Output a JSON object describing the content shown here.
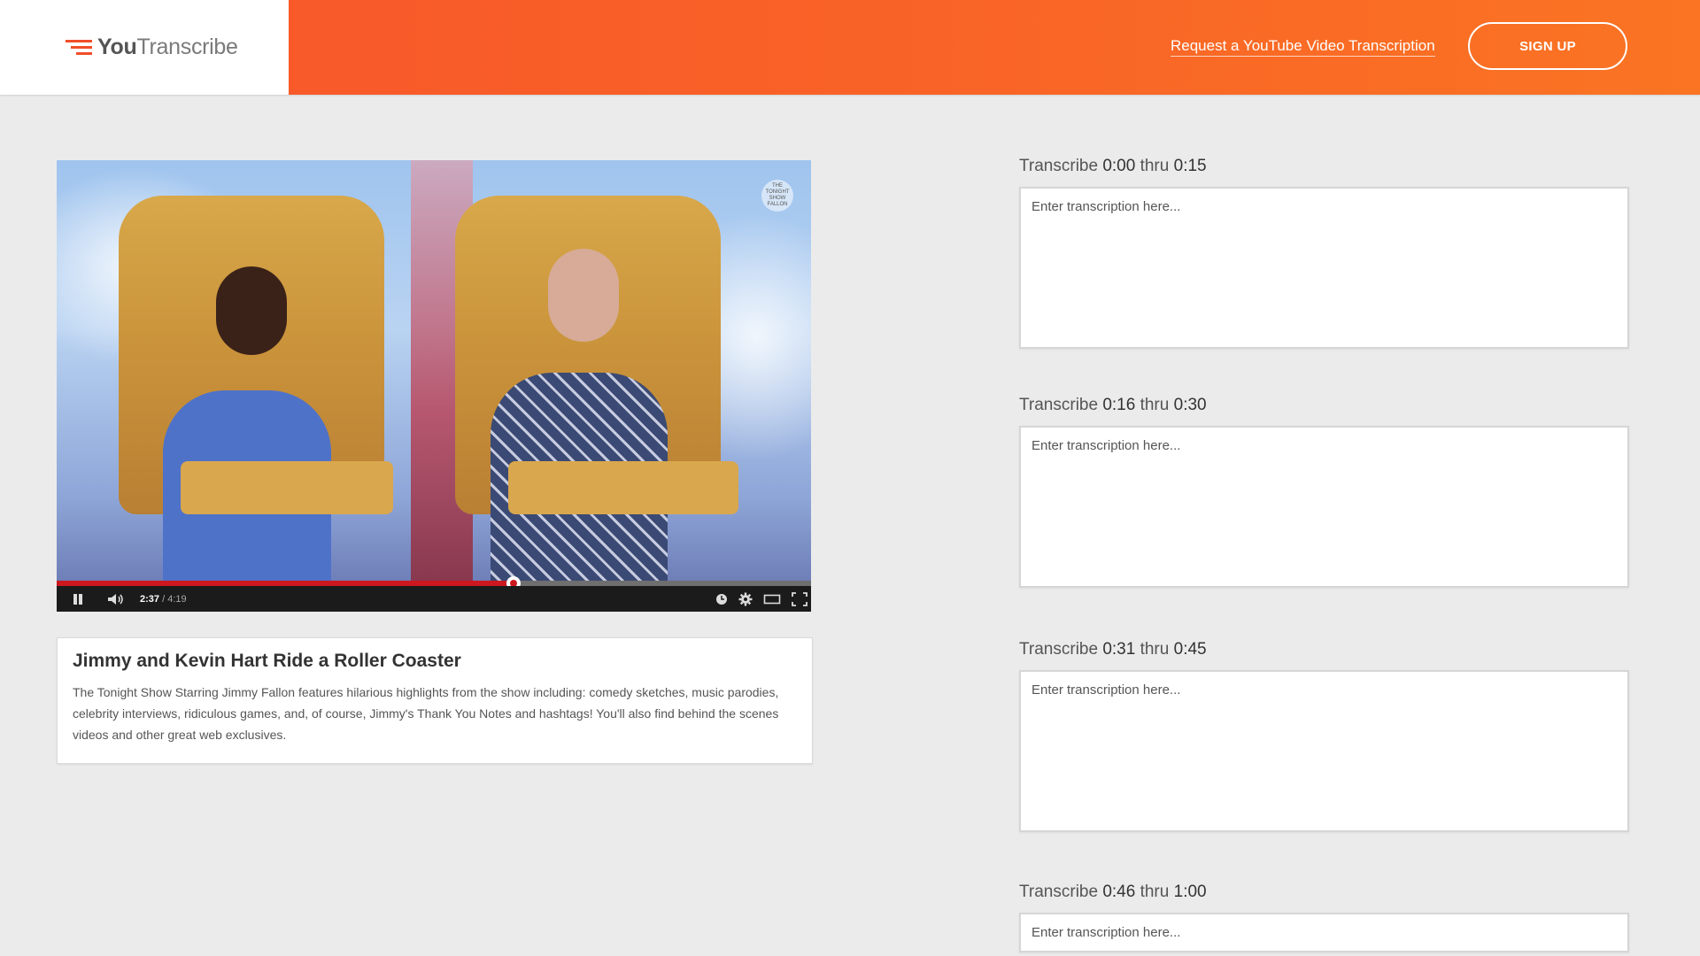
{
  "header": {
    "logo_you": "You",
    "logo_transcribe": "Transcribe",
    "request_link": "Request a YouTube Video Transcription",
    "signup_label": "SIGN UP",
    "colors": {
      "gradient_start": "#f8552a",
      "gradient_end": "#fa7423",
      "logo_mark": "#f04e2a"
    }
  },
  "video": {
    "time_current": "2:37",
    "time_separator": " / ",
    "time_total": "4:19",
    "progress": 0.6062,
    "progress_color": "#cc181e",
    "channel_badge": "THE TONIGHT SHOW FALLON",
    "icons": [
      "pause-icon",
      "volume-icon",
      "watch-later-icon",
      "settings-gear-icon",
      "theater-mode-icon",
      "fullscreen-icon"
    ]
  },
  "info": {
    "title": "Jimmy and Kevin Hart Ride a Roller Coaster",
    "description": "The Tonight Show Starring Jimmy Fallon features hilarious highlights from the show including: comedy sketches, music parodies, celebrity interviews, ridiculous games, and, of course, Jimmy's Thank You Notes and hashtags! You'll also find behind the scenes videos and other great web exclusives."
  },
  "transcribe": {
    "prefix": "Transcribe ",
    "thru": " thru ",
    "segments": [
      {
        "start": "0:00",
        "end": "0:15",
        "placeholder": "Enter transcription here..."
      },
      {
        "start": "0:16",
        "end": "0:30",
        "placeholder": "Enter transcription here..."
      },
      {
        "start": "0:31",
        "end": "0:45",
        "placeholder": "Enter transcription here..."
      },
      {
        "start": "0:46",
        "end": "1:00",
        "placeholder": "Enter transcription here..."
      }
    ]
  }
}
